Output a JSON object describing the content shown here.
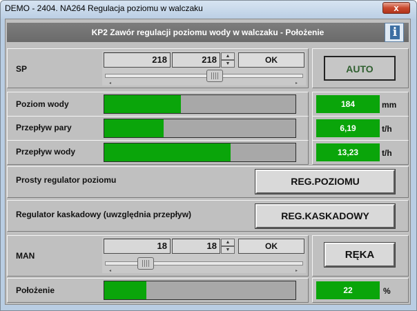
{
  "window": {
    "title": "DEMO - 2404. NA264 Regulacja poziomu w walczaku",
    "close_glyph": "x"
  },
  "header": {
    "title": "KP2 Zawór regulacji poziomu wody w walczaku - Położenie",
    "info_icon": "info-icon"
  },
  "sp": {
    "label": "SP",
    "current_value": "218",
    "input_value": "218",
    "ok_label": "OK",
    "slider_level": 0.56,
    "mode_label": "AUTO"
  },
  "measurements": [
    {
      "label": "Poziom wody",
      "value": "184",
      "unit": "mm",
      "fill": 0.4
    },
    {
      "label": "Przepływ pary",
      "value": "6,19",
      "unit": "t/h",
      "fill": 0.31
    },
    {
      "label": "Przepływ wody",
      "value": "13,23",
      "unit": "t/h",
      "fill": 0.66
    }
  ],
  "regulators": [
    {
      "label": "Prosty regulator poziomu",
      "button": "REG.POZIOMU"
    },
    {
      "label": "Regulator kaskadowy (uwzględnia przepływ)",
      "button": "REG.KASKADOWY"
    }
  ],
  "man": {
    "label": "MAN",
    "current_value": "18",
    "input_value": "18",
    "ok_label": "OK",
    "slider_level": 0.18,
    "mode_label": "RĘKA"
  },
  "position": {
    "label": "Położenie",
    "value": "22",
    "unit": "%",
    "fill": 0.22
  },
  "colors": {
    "green": "#0aa50a",
    "auto_text": "#2f5f2f"
  }
}
